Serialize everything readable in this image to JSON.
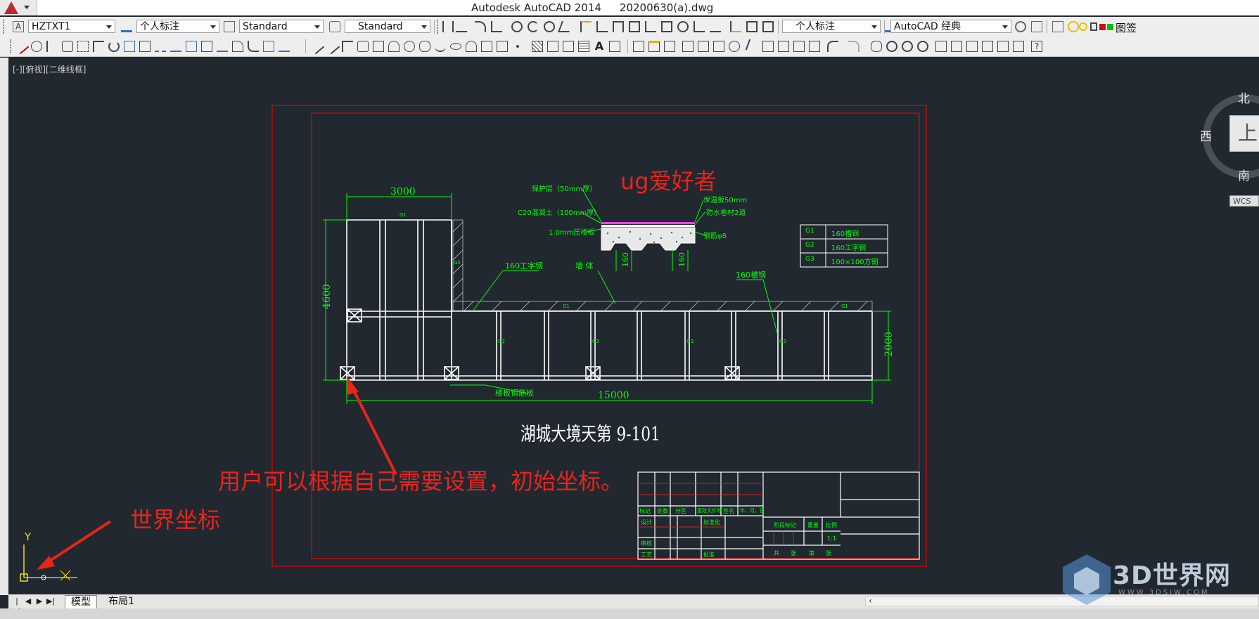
{
  "app": {
    "title": "Autodesk AutoCAD 2014",
    "file": "20200630(a).dwg"
  },
  "toolbar1": {
    "text_style": "HZTXT1",
    "dim_style": "个人标注",
    "table_style": "Standard",
    "multileader_style": "Standard",
    "dim_style_2": "个人标注",
    "workspace": "AutoCAD 经典",
    "label": "图签"
  },
  "viewport": {
    "label": "[-][俯视][二维线框]"
  },
  "viewcube": {
    "north": "北",
    "south": "南",
    "west": "西",
    "face": "上",
    "wcs": "WCS"
  },
  "drawing": {
    "dim_top": "3000",
    "dim_left": "4600",
    "dim_right": "2000",
    "dim_bottom": "15000",
    "title": "湖城大境天第 9-101",
    "section": {
      "l1": "保护层（50mm厚）",
      "l2": "C20混凝土（100mm厚）",
      "l3": "1.0mm压楼板",
      "r1": "保温板50mm",
      "r2": "防水卷材2道",
      "r3": "钢筋φ8",
      "d1": "160",
      "d2": "160"
    },
    "legend": [
      {
        "sym": "G1",
        "desc": "160槽钢"
      },
      {
        "sym": "G2",
        "desc": "160工字钢"
      },
      {
        "sym": "G3",
        "desc": "100×100方钢"
      }
    ],
    "labels": {
      "i_beam": "160工字钢",
      "wall": "墙 体",
      "channel": "160槽钢",
      "floor": "楼板钢筋板"
    },
    "tiny_tags": {
      "g1": "G1",
      "g2": "G2",
      "g3": "G3"
    },
    "titleblock": {
      "r1": [
        "标记",
        "处数",
        "分区",
        "更改文件号",
        "签名",
        "年、月、日"
      ],
      "r2": [
        "设计",
        "",
        "",
        "标准化"
      ],
      "r3a": "阶段标记",
      "r3b": "重量",
      "r3c": "比例",
      "r3d": "1:1",
      "r4": [
        "审核"
      ],
      "r5": [
        "工艺",
        "",
        "批准"
      ],
      "r6": [
        "共",
        "张",
        "第",
        "张"
      ]
    }
  },
  "annotations": {
    "brand": "ug爱好者",
    "note": "用户可以根据自己需要设置，初始坐标。",
    "world": "世界坐标"
  },
  "ucs": {
    "x": "X",
    "y": "Y"
  },
  "tabs": {
    "model": "模型",
    "layout1": "布局1"
  },
  "watermark": {
    "text": "3D世界网",
    "sub": "WWW.3DSJW.COM"
  },
  "colors": {
    "canvas": "#212830",
    "green": "#00ff00",
    "red": "#e8241b",
    "frame_red": "#ff0000",
    "white": "#ffffff"
  }
}
